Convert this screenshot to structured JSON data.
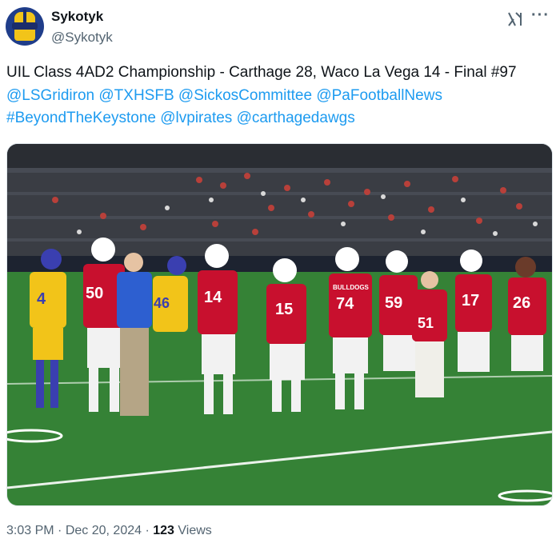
{
  "author": {
    "name": "Sykotyk",
    "handle": "@Sykotyk"
  },
  "icons": {
    "grok": "grok-icon",
    "more": "more-options-icon",
    "avatar": "helmet-avatar"
  },
  "tweet": {
    "intro": "UIL Class 4AD2 Championship - Carthage 28, Waco La Vega 14 - Final #97",
    "mentions": [
      "@LSGridiron",
      "@TXHSFB",
      "@SickosCommittee",
      "@PaFootballNews",
      "#BeyondTheKeystone",
      "@lvpirates",
      "@carthagedawgs"
    ]
  },
  "photo": {
    "jersey_numbers": [
      "4",
      "50",
      "46",
      "14",
      "15",
      "74",
      "59",
      "51",
      "17",
      "26"
    ],
    "team_text": "BULLDOGS"
  },
  "meta": {
    "time": "3:03 PM",
    "date": "Dec 20, 2024",
    "views_count": "123",
    "views_label": "Views",
    "sep": "·"
  },
  "colors": {
    "link": "#1d9bf0",
    "muted": "#536471",
    "text": "#0f1419",
    "carthage_red": "#c8102e",
    "lavega_gold": "#f2c419",
    "lavega_blue": "#3a3fb0"
  }
}
